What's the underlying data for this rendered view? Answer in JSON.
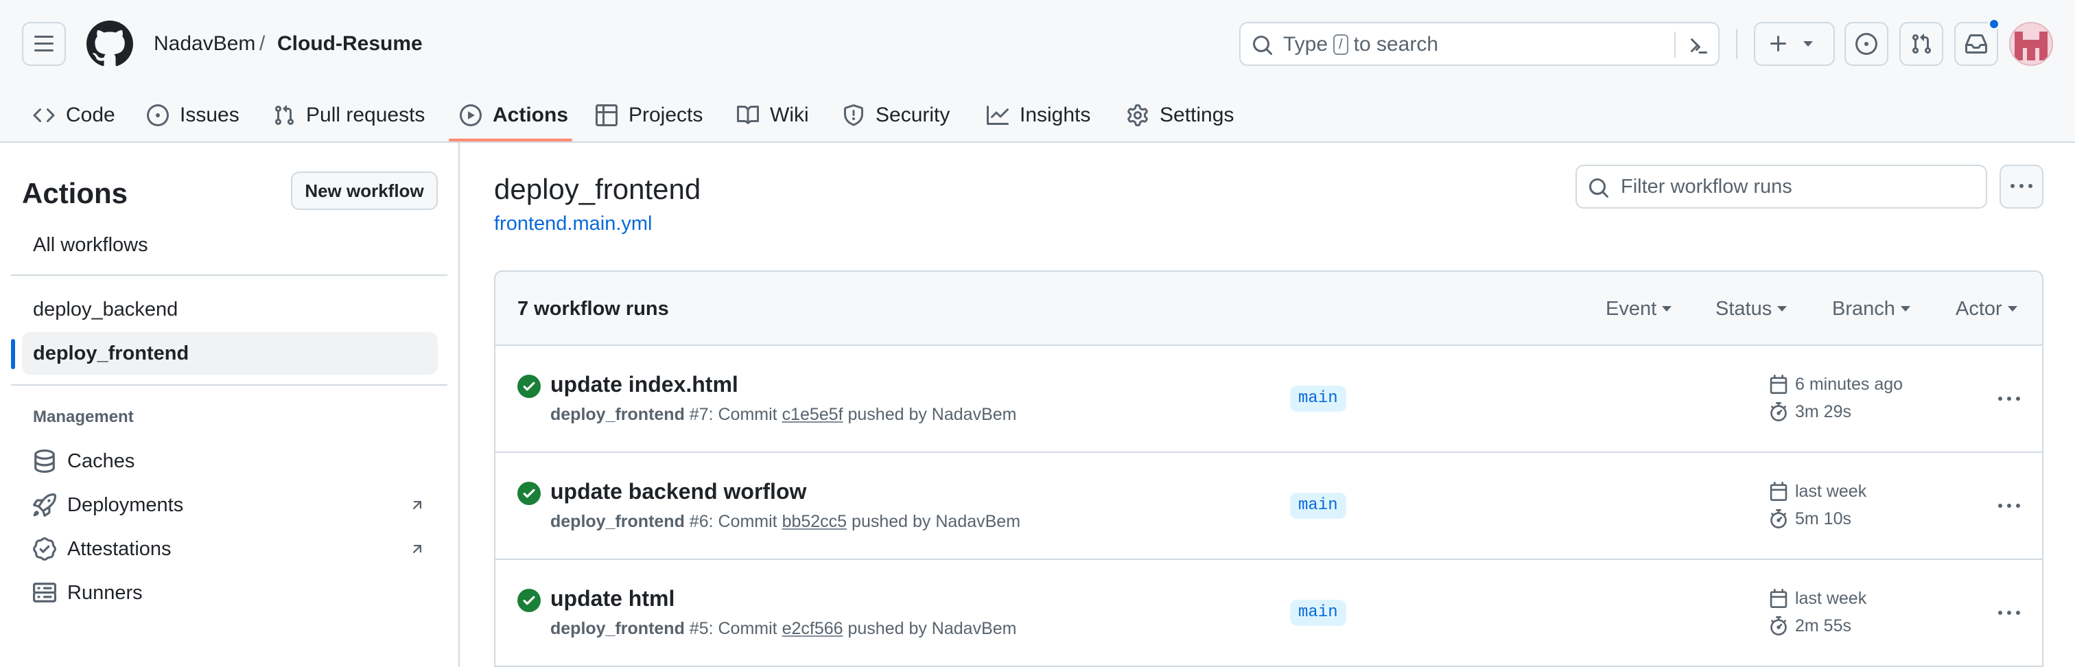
{
  "header": {
    "owner": "NadavBem",
    "separator": "/",
    "repo": "Cloud-Resume",
    "search": {
      "prefix": "Type",
      "key": "/",
      "suffix": "to search"
    }
  },
  "tabs": [
    {
      "label": "Code",
      "icon": "code-icon"
    },
    {
      "label": "Issues",
      "icon": "issue-icon"
    },
    {
      "label": "Pull requests",
      "icon": "pull-request-icon"
    },
    {
      "label": "Actions",
      "icon": "play-icon",
      "active": true
    },
    {
      "label": "Projects",
      "icon": "table-icon"
    },
    {
      "label": "Wiki",
      "icon": "book-icon"
    },
    {
      "label": "Security",
      "icon": "shield-icon"
    },
    {
      "label": "Insights",
      "icon": "graph-icon"
    },
    {
      "label": "Settings",
      "icon": "gear-icon"
    }
  ],
  "sidebar": {
    "title": "Actions",
    "new_workflow": "New workflow",
    "all_workflows": "All workflows",
    "workflows": [
      {
        "label": "deploy_backend"
      },
      {
        "label": "deploy_frontend",
        "selected": true
      }
    ],
    "section": "Management",
    "management": [
      {
        "label": "Caches",
        "icon": "database-icon"
      },
      {
        "label": "Deployments",
        "icon": "rocket-icon",
        "external": true
      },
      {
        "label": "Attestations",
        "icon": "verified-icon",
        "external": true
      },
      {
        "label": "Runners",
        "icon": "server-icon"
      }
    ]
  },
  "main": {
    "title": "deploy_frontend",
    "file": "frontend.main.yml",
    "filter_placeholder": "Filter workflow runs",
    "runs_count": "7 workflow runs",
    "filters": [
      "Event",
      "Status",
      "Branch",
      "Actor"
    ],
    "runs": [
      {
        "title": "update index.html",
        "workflow": "deploy_frontend",
        "number": "#7",
        "commit_label": ": Commit",
        "sha": "c1e5e5f",
        "pushed": "pushed by NadavBem",
        "branch": "main",
        "when": "6 minutes ago",
        "duration": "3m 29s",
        "status": "success"
      },
      {
        "title": "update backend worflow",
        "workflow": "deploy_frontend",
        "number": "#6",
        "commit_label": ": Commit",
        "sha": "bb52cc5",
        "pushed": "pushed by NadavBem",
        "branch": "main",
        "when": "last week",
        "duration": "5m 10s",
        "status": "success"
      },
      {
        "title": "update html",
        "workflow": "deploy_frontend",
        "number": "#5",
        "commit_label": ": Commit",
        "sha": "e2cf566",
        "pushed": "pushed by NadavBem",
        "branch": "main",
        "when": "last week",
        "duration": "2m 55s",
        "status": "success"
      }
    ]
  },
  "colors": {
    "accent": "#0969da",
    "success": "#1a7f37",
    "tab_underline": "#fd8c73",
    "border": "#d1d9e0"
  }
}
